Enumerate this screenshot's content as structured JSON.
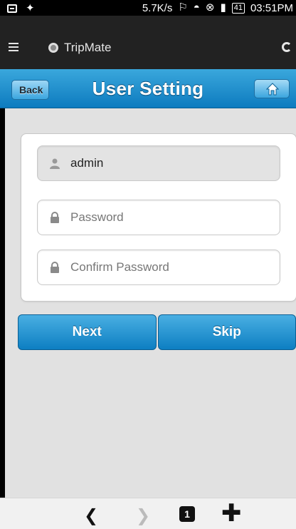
{
  "status_bar": {
    "net_speed": "5.7K/s",
    "battery": "41",
    "time": "03:51PM",
    "icons": [
      "screen-icon",
      "signal-strength-icon",
      "mute-icon",
      "wifi-icon",
      "notification-icon",
      "signal-icon",
      "battery-icon"
    ]
  },
  "browser": {
    "app_name": "TripMate",
    "icons": [
      "menu-icon",
      "app-logo-icon",
      "reload-icon"
    ]
  },
  "header": {
    "back_label": "Back",
    "title": "User Setting",
    "home_icon": "home-icon",
    "accent_color": "#1b8ed1"
  },
  "form": {
    "username_value": "admin",
    "password_placeholder": "Password",
    "confirm_placeholder": "Confirm Password"
  },
  "buttons": {
    "next_label": "Next",
    "skip_label": "Skip"
  },
  "bottom_nav": {
    "tab_count": "1",
    "back_glyph": "❮",
    "forward_glyph": "❯",
    "new_tab_glyph": "✚"
  }
}
